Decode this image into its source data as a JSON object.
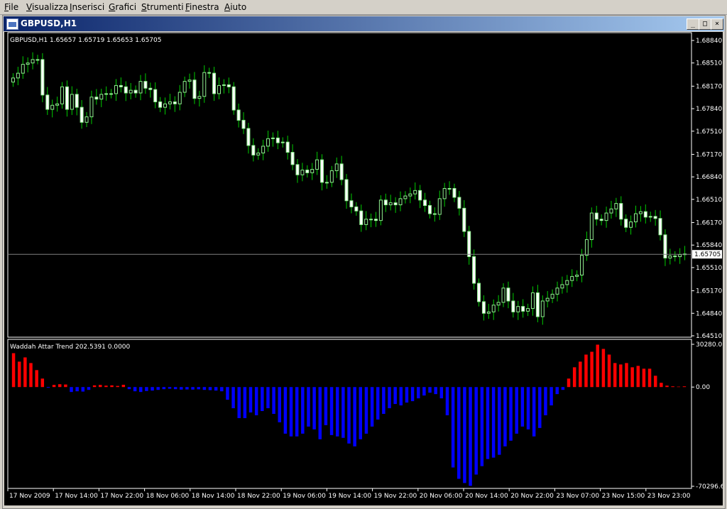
{
  "menu": [
    "File",
    "Visualizza",
    "Inserisci",
    "Grafici",
    "Strumenti",
    "Finestra",
    "Aiuto"
  ],
  "window": {
    "title": "GBPUSD,H1",
    "min_label": "_",
    "max_label": "□",
    "close_label": "×"
  },
  "colors": {
    "bull": "#90ee90",
    "bear": "#ffffff",
    "wick": "#00cc00",
    "up_bar": "#ff0000",
    "down_bar": "#0000ff",
    "grid": "#ffffff",
    "bg": "#000000"
  },
  "price_chart": {
    "legend": "GBPUSD,H1  1.65657 1.65719 1.65653 1.65705",
    "price_min": 1.6451,
    "price_max": 1.6884,
    "y_ticks": [
      "1.68840",
      "1.68510",
      "1.68170",
      "1.67840",
      "1.67510",
      "1.67170",
      "1.66840",
      "1.66510",
      "1.66170",
      "1.65840",
      "1.65510",
      "1.65170",
      "1.64840",
      "1.64510"
    ],
    "current_price": 1.65705,
    "current_price_label": "1.65705",
    "closes": [
      1.6829,
      1.6836,
      1.6849,
      1.6851,
      1.6856,
      1.6856,
      1.6804,
      1.6783,
      1.6789,
      1.6791,
      1.6816,
      1.6783,
      1.6805,
      1.6786,
      1.6764,
      1.6772,
      1.6801,
      1.6798,
      1.6805,
      1.6806,
      1.6806,
      1.6818,
      1.6816,
      1.6807,
      1.6811,
      1.6807,
      1.6824,
      1.6814,
      1.6812,
      1.6794,
      1.6786,
      1.6791,
      1.6794,
      1.6791,
      1.6808,
      1.6824,
      1.6826,
      1.6799,
      1.6802,
      1.6837,
      1.6836,
      1.6806,
      1.6818,
      1.6819,
      1.6816,
      1.6782,
      1.6767,
      1.6755,
      1.673,
      1.6716,
      1.6719,
      1.6729,
      1.674,
      1.6741,
      1.6734,
      1.6735,
      1.672,
      1.6702,
      1.6687,
      1.6694,
      1.669,
      1.6695,
      1.6709,
      1.6676,
      1.6676,
      1.6693,
      1.6703,
      1.668,
      1.6649,
      1.664,
      1.6634,
      1.6614,
      1.6622,
      1.6622,
      1.662,
      1.665,
      1.6643,
      1.6646,
      1.6643,
      1.6652,
      1.6656,
      1.6659,
      1.6664,
      1.665,
      1.6642,
      1.663,
      1.6629,
      1.6652,
      1.6667,
      1.6667,
      1.6654,
      1.6638,
      1.6604,
      1.6567,
      1.6528,
      1.6501,
      1.6484,
      1.6486,
      1.6496,
      1.65,
      1.6521,
      1.6502,
      1.6486,
      1.6494,
      1.6487,
      1.6491,
      1.6514,
      1.6479,
      1.6502,
      1.6506,
      1.6512,
      1.6521,
      1.6526,
      1.6532,
      1.6538,
      1.654,
      1.6569,
      1.6592,
      1.6631,
      1.6622,
      1.662,
      1.6631,
      1.6637,
      1.6645,
      1.6622,
      1.661,
      1.6618,
      1.663,
      1.6633,
      1.6625,
      1.6626,
      1.6623,
      1.6599,
      1.6565,
      1.6568,
      1.6567,
      1.657,
      1.6571
    ]
  },
  "indicator": {
    "legend": "Waddah Attar Trend 202.5391 0.0000",
    "value_max": 30280.01,
    "value_min": -70296.6,
    "y_ticks": [
      "30280.01",
      "0.00",
      "-70296.6"
    ],
    "values": [
      24000,
      18000,
      21000,
      17000,
      12000,
      6000,
      -500,
      1500,
      2000,
      1800,
      -3500,
      -3000,
      -3200,
      -2000,
      1200,
      1500,
      1000,
      1200,
      800,
      1600,
      -1500,
      -3000,
      -3500,
      -2800,
      -2500,
      -2000,
      -1500,
      -1200,
      -1500,
      -1800,
      -1700,
      -1800,
      -1600,
      -2000,
      -2200,
      -2500,
      -3000,
      -9000,
      -15000,
      -22000,
      -22000,
      -18000,
      -20000,
      -17000,
      -15000,
      -19000,
      -25000,
      -33000,
      -35000,
      -35000,
      -33000,
      -28000,
      -30000,
      -37000,
      -27000,
      -34000,
      -35000,
      -36000,
      -40000,
      -42000,
      -37000,
      -33000,
      -28000,
      -23000,
      -19000,
      -15000,
      -12000,
      -13000,
      -11000,
      -10000,
      -8000,
      -6000,
      -4000,
      -5000,
      -8000,
      -20000,
      -57000,
      -65000,
      -68000,
      -70000,
      -62000,
      -56000,
      -51000,
      -50000,
      -48000,
      -42000,
      -38000,
      -33000,
      -28000,
      -30000,
      -35000,
      -29000,
      -20000,
      -13000,
      -5000,
      -2000,
      6000,
      14000,
      18000,
      23000,
      25000,
      30000,
      27000,
      23000,
      17000,
      16000,
      17000,
      14000,
      15000,
      13000,
      13000,
      8000,
      3000,
      1000,
      500,
      300,
      500
    ]
  },
  "time_axis": [
    "17 Nov 2009",
    "17 Nov 14:00",
    "17 Nov 22:00",
    "18 Nov 06:00",
    "18 Nov 14:00",
    "18 Nov 22:00",
    "19 Nov 06:00",
    "19 Nov 14:00",
    "19 Nov 22:00",
    "20 Nov 06:00",
    "20 Nov 14:00",
    "20 Nov 22:00",
    "23 Nov 07:00",
    "23 Nov 15:00",
    "23 Nov 23:00"
  ]
}
